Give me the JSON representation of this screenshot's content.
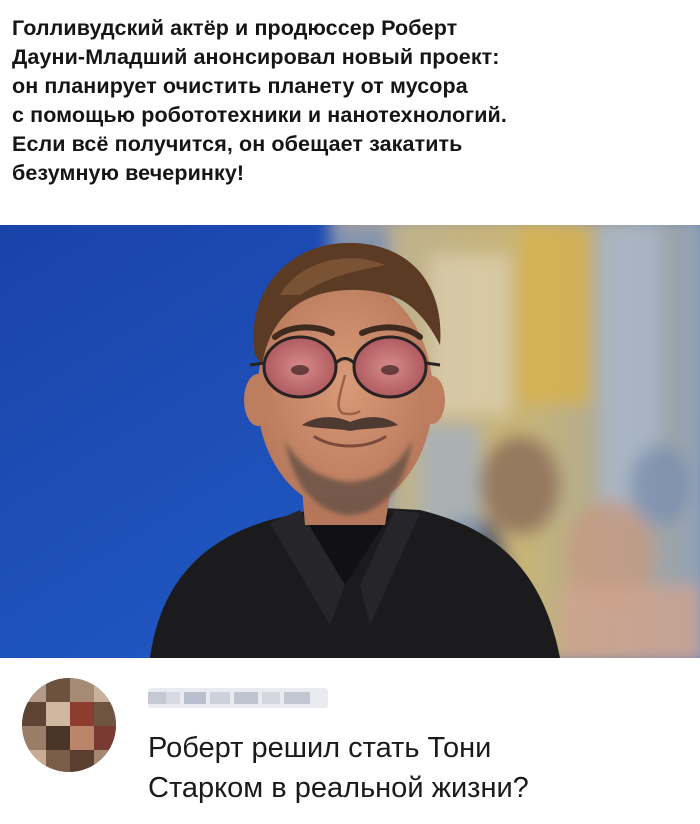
{
  "headline": {
    "lines": [
      "Голливудский актёр и продюссер Роберт",
      "Дауни-Младший анонсировал новый проект:",
      "он планирует очистить планету от мусора",
      "с помощью робототехники и нанотехнологий.",
      "Если всё получится, он обещает закатить",
      "безумную вечеринку!"
    ]
  },
  "comment": {
    "text_lines": [
      "Роберт решил стать Тони",
      "Старком в реальной жизни?"
    ]
  },
  "colors": {
    "backdrop_blue": "#1d4fb5",
    "jacket": "#1a1a1c",
    "skin": "#c98a68",
    "hair": "#5a3a24",
    "lens_tint": "#c46a6f",
    "text": "#151515"
  }
}
